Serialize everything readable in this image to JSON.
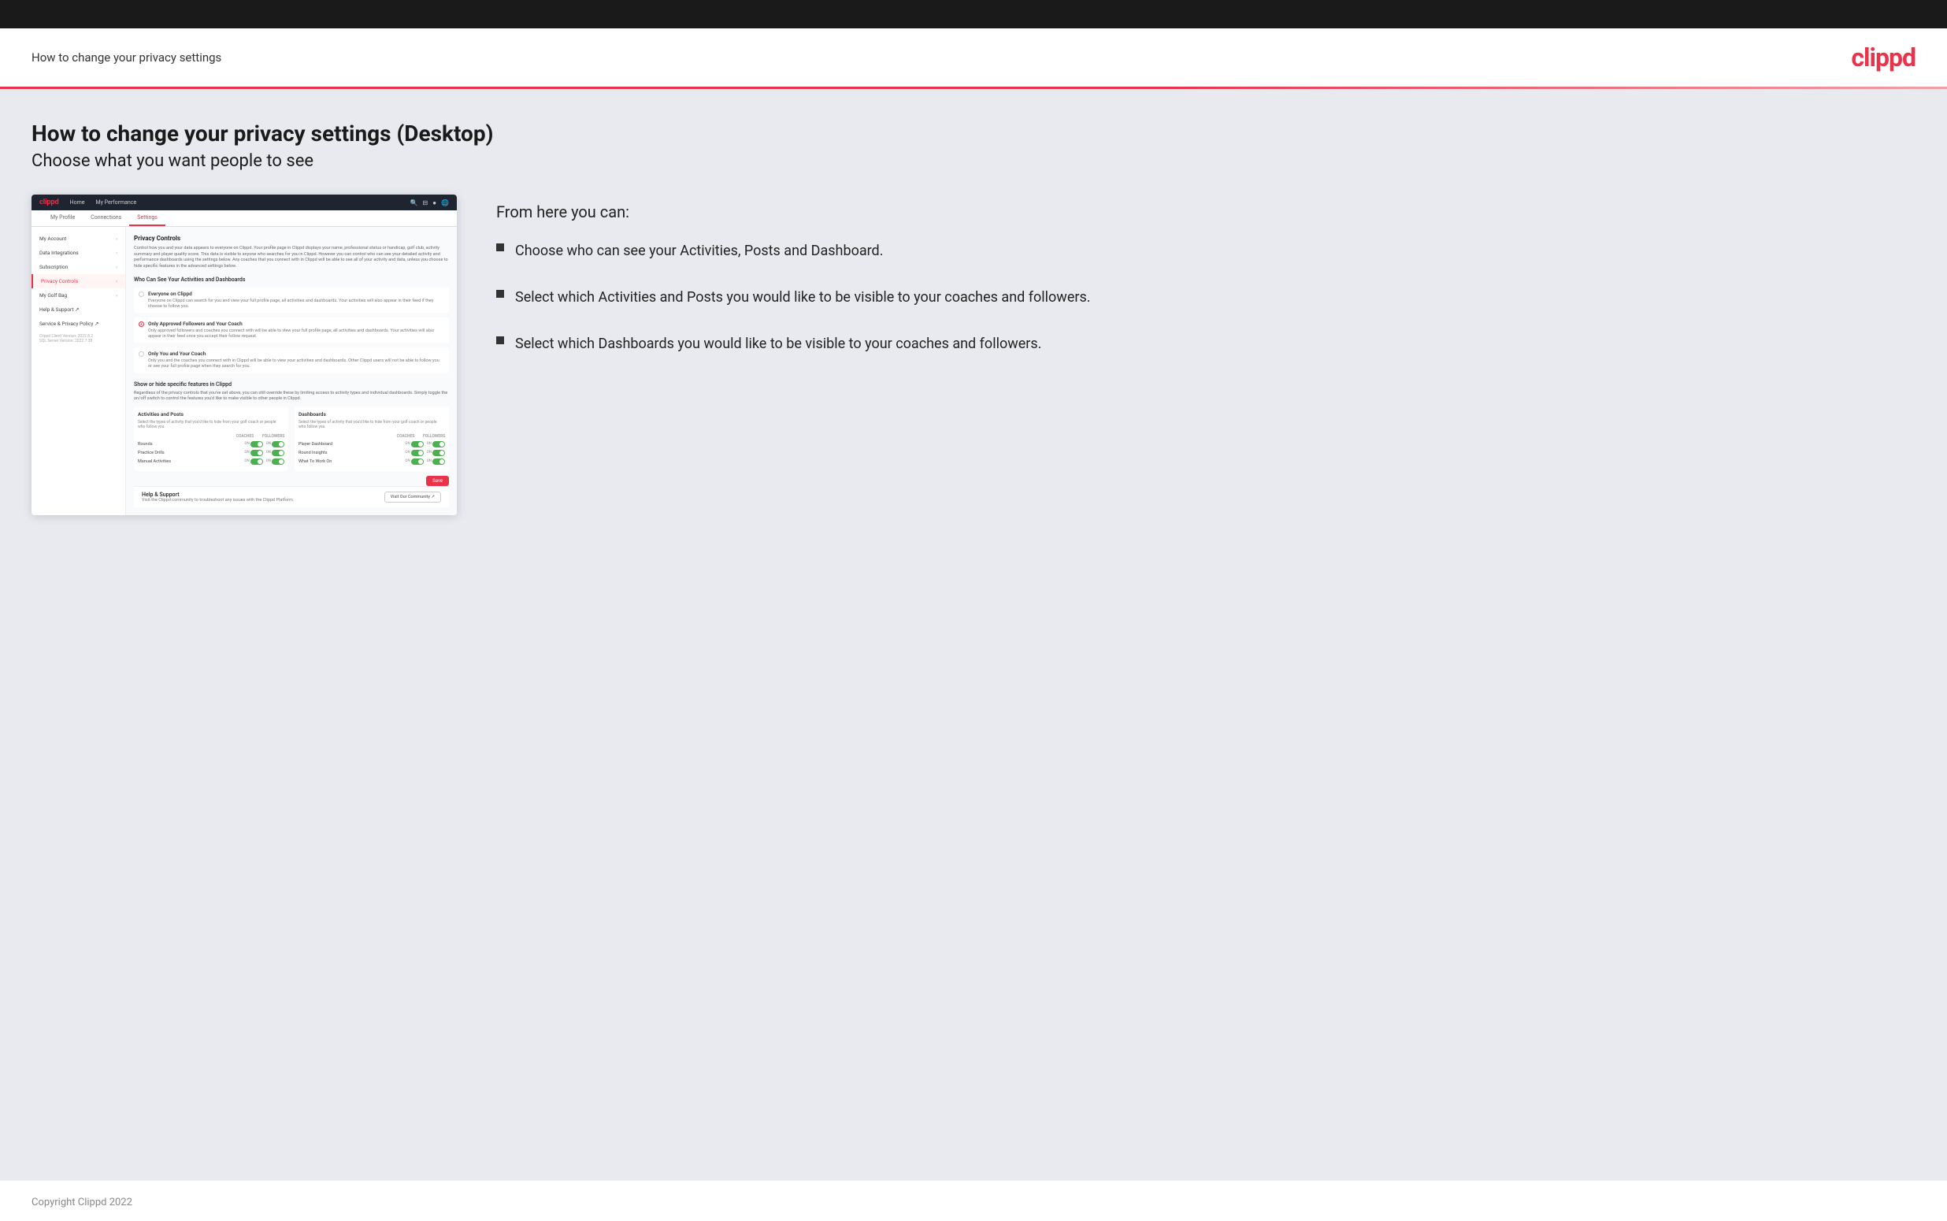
{
  "header": {
    "title": "How to change your privacy settings",
    "logo": "clippd"
  },
  "page": {
    "main_title": "How to change your privacy settings (Desktop)",
    "subtitle": "Choose what you want people to see"
  },
  "right_panel": {
    "from_here_title": "From here you can:",
    "bullets": [
      "Choose who can see your Activities, Posts and Dashboard.",
      "Select which Activities and Posts you would like to be visible to your coaches and followers.",
      "Select which Dashboards you would like to be visible to your coaches and followers."
    ]
  },
  "mock_app": {
    "nav": {
      "logo": "clippd",
      "links": [
        "Home",
        "My Performance"
      ],
      "icons": [
        "🔍",
        "☁",
        "👤",
        "🌐"
      ]
    },
    "tabs": [
      "My Profile",
      "Connections",
      "Settings"
    ],
    "active_tab": "Settings",
    "sidebar": {
      "items": [
        {
          "label": "My Account",
          "active": false,
          "has_arrow": true
        },
        {
          "label": "Data Integrations",
          "active": false,
          "has_arrow": true
        },
        {
          "label": "Subscription",
          "active": false,
          "has_arrow": true
        },
        {
          "label": "Privacy Controls",
          "active": true,
          "has_arrow": true
        },
        {
          "label": "My Golf Bag",
          "active": false,
          "has_arrow": true
        },
        {
          "label": "Help & Support ↗",
          "active": false,
          "has_arrow": false
        },
        {
          "label": "Service & Privacy Policy ↗",
          "active": false,
          "has_arrow": false
        }
      ],
      "version": "Clippd Client Version: 2022.8.2\nSQL Server Version: 2022.7.38"
    },
    "main": {
      "privacy_controls_title": "Privacy Controls",
      "privacy_controls_desc": "Control how you and your data appears to everyone on Clippd. Your profile page in Clippd displays your name, professional status or handicap, golf club, activity summary and player quality score. This data is visible to anyone who searches for you in Clippd. However you can control who can see your detailed activity and performance dashboards using the settings below. Any coaches that you connect with in Clippd will be able to see all of your activity and data, unless you choose to hide specific features in the advanced settings below.",
      "who_can_see_title": "Who Can See Your Activities and Dashboards",
      "radio_options": [
        {
          "id": "everyone",
          "label": "Everyone on Clippd",
          "desc": "Everyone on Clippd can search for you and view your full profile page, all activities and dashboards. Your activities will also appear in their feed if they choose to follow you.",
          "selected": false
        },
        {
          "id": "followers",
          "label": "Only Approved Followers and Your Coach",
          "desc": "Only approved followers and coaches you connect with will be able to view your full profile page, all activities and dashboards. Your activities will also appear in their feed once you accept their follow request.",
          "selected": true
        },
        {
          "id": "coach_only",
          "label": "Only You and Your Coach",
          "desc": "Only you and the coaches you connect with in Clippd will be able to view your activities and dashboards. Other Clippd users will not be able to follow you or see your full profile page when they search for you.",
          "selected": false
        }
      ],
      "show_hide_title": "Show or hide specific features in Clippd",
      "show_hide_desc": "Regardless of the privacy controls that you've set above, you can still override these by limiting access to activity types and individual dashboards. Simply toggle the on/off switch to control the features you'd like to make visible to other people in Clippd.",
      "activities_posts": {
        "title": "Activities and Posts",
        "desc": "Select the types of activity that you'd like to hide from your golf coach or people who follow you.",
        "columns": [
          "COACHES",
          "FOLLOWERS"
        ],
        "rows": [
          {
            "label": "Rounds",
            "coaches_on": true,
            "followers_on": true
          },
          {
            "label": "Practice Drills",
            "coaches_on": true,
            "followers_on": true
          },
          {
            "label": "Manual Activities",
            "coaches_on": true,
            "followers_on": true
          }
        ]
      },
      "dashboards": {
        "title": "Dashboards",
        "desc": "Select the types of activity that you'd like to hide from your golf coach or people who follow you.",
        "columns": [
          "COACHES",
          "FOLLOWERS"
        ],
        "rows": [
          {
            "label": "Player Dashboard",
            "coaches_on": true,
            "followers_on": true
          },
          {
            "label": "Round Insights",
            "coaches_on": true,
            "followers_on": true
          },
          {
            "label": "What To Work On",
            "coaches_on": true,
            "followers_on": true
          }
        ]
      },
      "save_label": "Save",
      "help_section": {
        "title": "Help & Support",
        "desc": "Visit the Clippd community to troubleshoot any issues with the Clippd Platform.",
        "button_label": "Visit Our Community ↗"
      }
    }
  },
  "footer": {
    "text": "Copyright Clippd 2022"
  }
}
